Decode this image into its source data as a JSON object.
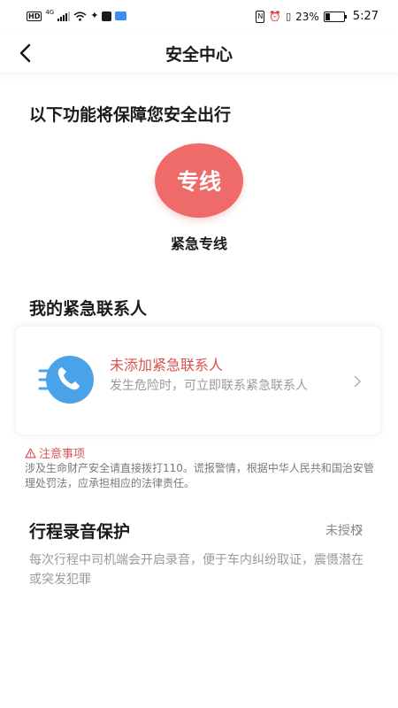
{
  "status_bar": {
    "hd_badge": "HD",
    "network": "4G",
    "battery_percent": "23%",
    "battery_level": 0.23,
    "time": "5:27"
  },
  "nav": {
    "title": "安全中心"
  },
  "features": {
    "section_title": "以下功能将保障您安全出行",
    "hotline_button": "专线",
    "hotline_label": "紧急专线"
  },
  "contacts": {
    "section_title": "我的紧急联系人",
    "card_title": "未添加紧急联系人",
    "card_desc": "发生危险时，可立即联系紧急联系人"
  },
  "notice": {
    "title": "注意事项",
    "body": "涉及生命财产安全请直接拨打110。谎报警情，根据中华人民共和国治安管理处罚法，应承担相应的法律责任。"
  },
  "recording": {
    "title": "行程录音保护",
    "status": "未授权",
    "desc": "每次行程中司机端会开启录音，便于车内纠纷取证，震慑潜在或突发犯罪"
  },
  "colors": {
    "accent_red": "#ee6b69",
    "warning_red": "#d9534f",
    "phone_blue": "#4aa3e8"
  }
}
